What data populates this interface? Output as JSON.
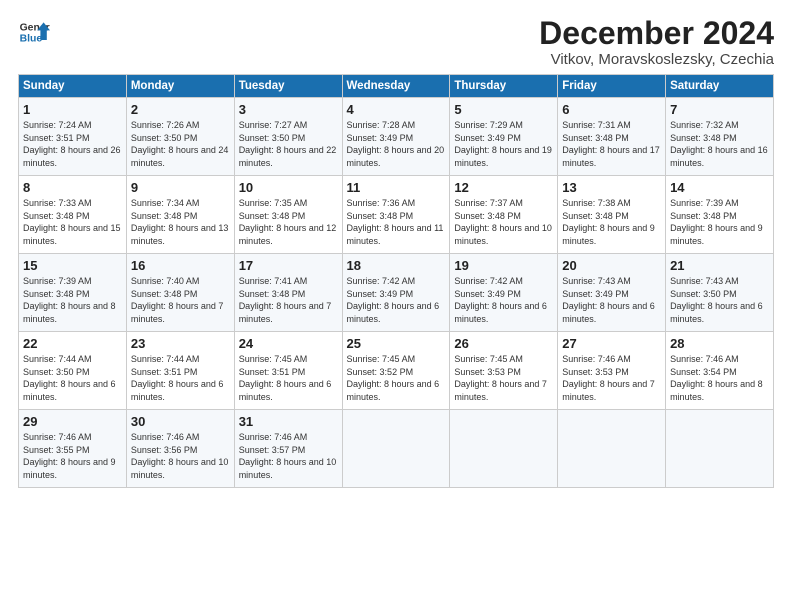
{
  "logo": {
    "line1": "General",
    "line2": "Blue"
  },
  "title": "December 2024",
  "subtitle": "Vitkov, Moravskoslezsky, Czechia",
  "days_header": [
    "Sunday",
    "Monday",
    "Tuesday",
    "Wednesday",
    "Thursday",
    "Friday",
    "Saturday"
  ],
  "weeks": [
    [
      {
        "day": "1",
        "rise": "Sunrise: 7:24 AM",
        "set": "Sunset: 3:51 PM",
        "daylight": "Daylight: 8 hours and 26 minutes."
      },
      {
        "day": "2",
        "rise": "Sunrise: 7:26 AM",
        "set": "Sunset: 3:50 PM",
        "daylight": "Daylight: 8 hours and 24 minutes."
      },
      {
        "day": "3",
        "rise": "Sunrise: 7:27 AM",
        "set": "Sunset: 3:50 PM",
        "daylight": "Daylight: 8 hours and 22 minutes."
      },
      {
        "day": "4",
        "rise": "Sunrise: 7:28 AM",
        "set": "Sunset: 3:49 PM",
        "daylight": "Daylight: 8 hours and 20 minutes."
      },
      {
        "day": "5",
        "rise": "Sunrise: 7:29 AM",
        "set": "Sunset: 3:49 PM",
        "daylight": "Daylight: 8 hours and 19 minutes."
      },
      {
        "day": "6",
        "rise": "Sunrise: 7:31 AM",
        "set": "Sunset: 3:48 PM",
        "daylight": "Daylight: 8 hours and 17 minutes."
      },
      {
        "day": "7",
        "rise": "Sunrise: 7:32 AM",
        "set": "Sunset: 3:48 PM",
        "daylight": "Daylight: 8 hours and 16 minutes."
      }
    ],
    [
      {
        "day": "8",
        "rise": "Sunrise: 7:33 AM",
        "set": "Sunset: 3:48 PM",
        "daylight": "Daylight: 8 hours and 15 minutes."
      },
      {
        "day": "9",
        "rise": "Sunrise: 7:34 AM",
        "set": "Sunset: 3:48 PM",
        "daylight": "Daylight: 8 hours and 13 minutes."
      },
      {
        "day": "10",
        "rise": "Sunrise: 7:35 AM",
        "set": "Sunset: 3:48 PM",
        "daylight": "Daylight: 8 hours and 12 minutes."
      },
      {
        "day": "11",
        "rise": "Sunrise: 7:36 AM",
        "set": "Sunset: 3:48 PM",
        "daylight": "Daylight: 8 hours and 11 minutes."
      },
      {
        "day": "12",
        "rise": "Sunrise: 7:37 AM",
        "set": "Sunset: 3:48 PM",
        "daylight": "Daylight: 8 hours and 10 minutes."
      },
      {
        "day": "13",
        "rise": "Sunrise: 7:38 AM",
        "set": "Sunset: 3:48 PM",
        "daylight": "Daylight: 8 hours and 9 minutes."
      },
      {
        "day": "14",
        "rise": "Sunrise: 7:39 AM",
        "set": "Sunset: 3:48 PM",
        "daylight": "Daylight: 8 hours and 9 minutes."
      }
    ],
    [
      {
        "day": "15",
        "rise": "Sunrise: 7:39 AM",
        "set": "Sunset: 3:48 PM",
        "daylight": "Daylight: 8 hours and 8 minutes."
      },
      {
        "day": "16",
        "rise": "Sunrise: 7:40 AM",
        "set": "Sunset: 3:48 PM",
        "daylight": "Daylight: 8 hours and 7 minutes."
      },
      {
        "day": "17",
        "rise": "Sunrise: 7:41 AM",
        "set": "Sunset: 3:48 PM",
        "daylight": "Daylight: 8 hours and 7 minutes."
      },
      {
        "day": "18",
        "rise": "Sunrise: 7:42 AM",
        "set": "Sunset: 3:49 PM",
        "daylight": "Daylight: 8 hours and 6 minutes."
      },
      {
        "day": "19",
        "rise": "Sunrise: 7:42 AM",
        "set": "Sunset: 3:49 PM",
        "daylight": "Daylight: 8 hours and 6 minutes."
      },
      {
        "day": "20",
        "rise": "Sunrise: 7:43 AM",
        "set": "Sunset: 3:49 PM",
        "daylight": "Daylight: 8 hours and 6 minutes."
      },
      {
        "day": "21",
        "rise": "Sunrise: 7:43 AM",
        "set": "Sunset: 3:50 PM",
        "daylight": "Daylight: 8 hours and 6 minutes."
      }
    ],
    [
      {
        "day": "22",
        "rise": "Sunrise: 7:44 AM",
        "set": "Sunset: 3:50 PM",
        "daylight": "Daylight: 8 hours and 6 minutes."
      },
      {
        "day": "23",
        "rise": "Sunrise: 7:44 AM",
        "set": "Sunset: 3:51 PM",
        "daylight": "Daylight: 8 hours and 6 minutes."
      },
      {
        "day": "24",
        "rise": "Sunrise: 7:45 AM",
        "set": "Sunset: 3:51 PM",
        "daylight": "Daylight: 8 hours and 6 minutes."
      },
      {
        "day": "25",
        "rise": "Sunrise: 7:45 AM",
        "set": "Sunset: 3:52 PM",
        "daylight": "Daylight: 8 hours and 6 minutes."
      },
      {
        "day": "26",
        "rise": "Sunrise: 7:45 AM",
        "set": "Sunset: 3:53 PM",
        "daylight": "Daylight: 8 hours and 7 minutes."
      },
      {
        "day": "27",
        "rise": "Sunrise: 7:46 AM",
        "set": "Sunset: 3:53 PM",
        "daylight": "Daylight: 8 hours and 7 minutes."
      },
      {
        "day": "28",
        "rise": "Sunrise: 7:46 AM",
        "set": "Sunset: 3:54 PM",
        "daylight": "Daylight: 8 hours and 8 minutes."
      }
    ],
    [
      {
        "day": "29",
        "rise": "Sunrise: 7:46 AM",
        "set": "Sunset: 3:55 PM",
        "daylight": "Daylight: 8 hours and 9 minutes."
      },
      {
        "day": "30",
        "rise": "Sunrise: 7:46 AM",
        "set": "Sunset: 3:56 PM",
        "daylight": "Daylight: 8 hours and 10 minutes."
      },
      {
        "day": "31",
        "rise": "Sunrise: 7:46 AM",
        "set": "Sunset: 3:57 PM",
        "daylight": "Daylight: 8 hours and 10 minutes."
      },
      null,
      null,
      null,
      null
    ]
  ]
}
